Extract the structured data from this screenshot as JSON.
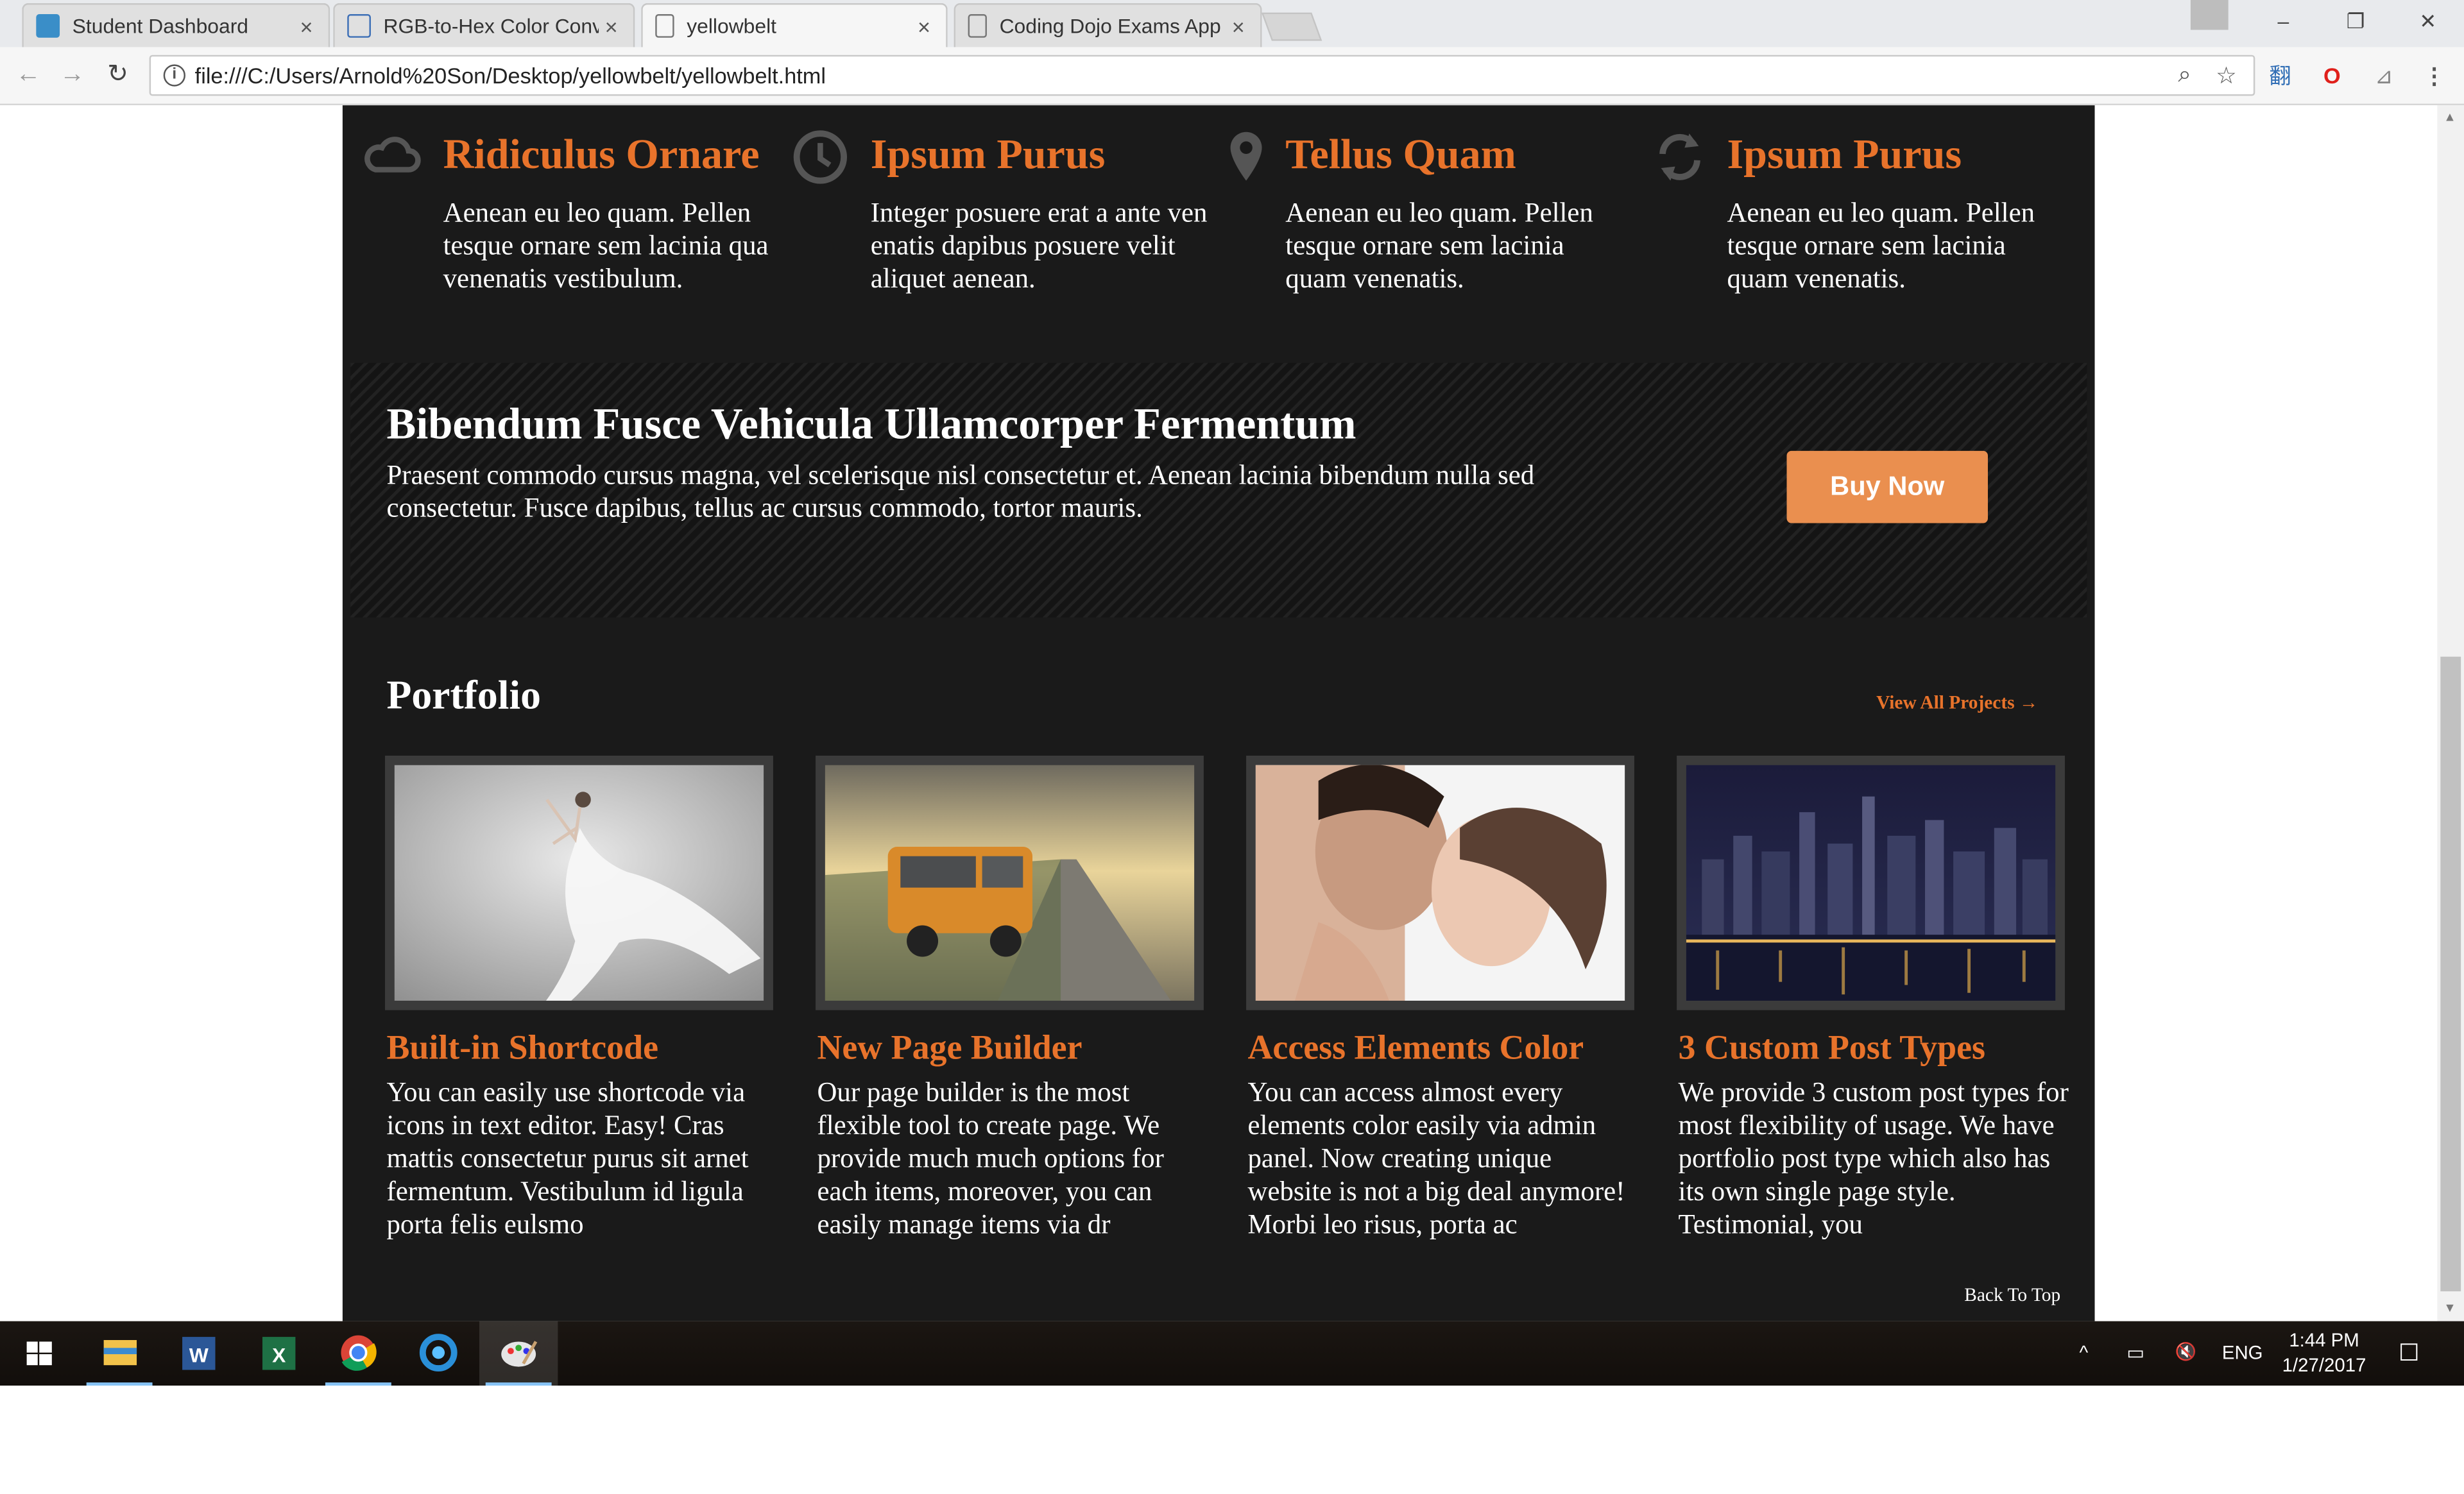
{
  "browser": {
    "tabs": [
      {
        "title": "Student Dashboard",
        "close": "×"
      },
      {
        "title": "RGB-to-Hex Color Conve",
        "close": "×"
      },
      {
        "title": "yellowbelt",
        "close": "×"
      },
      {
        "title": "Coding Dojo Exams App",
        "close": "×"
      }
    ],
    "url": "file:///C:/Users/Arnold%20Son/Desktop/yellowbelt/yellowbelt.html",
    "info_icon": "i",
    "window_controls": {
      "minimize": "–",
      "restore": "❐",
      "close": "✕"
    },
    "nav": {
      "back": "←",
      "forward": "→",
      "reload": "↻"
    },
    "omnibox_icons": {
      "zoom": "⌕",
      "bookmark": "☆"
    },
    "extensions": [
      "翻",
      "O",
      "⊿",
      "⋮"
    ]
  },
  "colors": {
    "accent": "#e8732b",
    "button": "#ea8f4f",
    "site_background": "#1a1a1a"
  },
  "features": [
    {
      "icon": "cloud-icon",
      "title": "Ridiculus Ornare",
      "text": "Aenean eu leo quam. Pellen tesque ornare sem lacinia qua venenatis vestibulum."
    },
    {
      "icon": "clock-icon",
      "title": "Ipsum Purus",
      "text": "Integer posuere erat a ante ven enatis dapibus posuere velit aliquet aenean."
    },
    {
      "icon": "map-pin-icon",
      "title": "Tellus Quam",
      "text": "Aenean eu leo quam. Pellen tesque ornare sem lacinia quam venenatis."
    },
    {
      "icon": "refresh-icon",
      "title": "Ipsum Purus",
      "text": "Aenean eu leo quam. Pellen tesque ornare sem lacinia quam venenatis."
    }
  ],
  "promo": {
    "title": "Bibendum Fusce Vehicula Ullamcorper Fermentum",
    "text": "Praesent commodo cursus magna, vel scelerisque nisl consectetur et. Aenean lacinia bibendum nulla sed consectetur. Fusce dapibus, tellus ac cursus commodo, tortor mauris.",
    "button": "Buy Now"
  },
  "portfolio": {
    "heading": "Portfolio",
    "view_all": "View All Projects →",
    "items": [
      {
        "image": "dancer-photo",
        "title": "Built-in Shortcode",
        "text": "You can easily use shortcode via icons in text editor. Easy! Cras mattis consectetur purus sit arnet fermentum. Vestibulum id ligula porta felis eulsmo"
      },
      {
        "image": "bus-photo",
        "title": "New Page Builder",
        "text": "Our page builder is the most flexible tool to create page. We provide much much options for each items, moreover, you can easily manage items via dr"
      },
      {
        "image": "couple-photo",
        "title": "Access Elements Color",
        "text": "You can access almost every elements color easily via admin panel. Now creating unique website is not a big deal anymore! Morbi leo risus, porta ac"
      },
      {
        "image": "city-photo",
        "title": "3 Custom Post Types",
        "text": "We provide 3 custom post types for most flexibility of usage. We have portfolio post type which also has its own single page style. Testimonial, you"
      }
    ],
    "back_to_top": "Back To Top"
  },
  "taskbar": {
    "apps": [
      "windows-start-icon",
      "file-explorer-icon",
      "word-icon",
      "excel-icon",
      "chrome-icon",
      "blue-app-icon",
      "paint-app-icon"
    ],
    "app_glyphs": {
      "word": "W",
      "excel": "X"
    },
    "tray": {
      "chevron": "^",
      "battery": "▭",
      "volume": "🔇",
      "language": "ENG",
      "notifications": "☐"
    },
    "time": "1:44 PM",
    "date": "1/27/2017"
  }
}
